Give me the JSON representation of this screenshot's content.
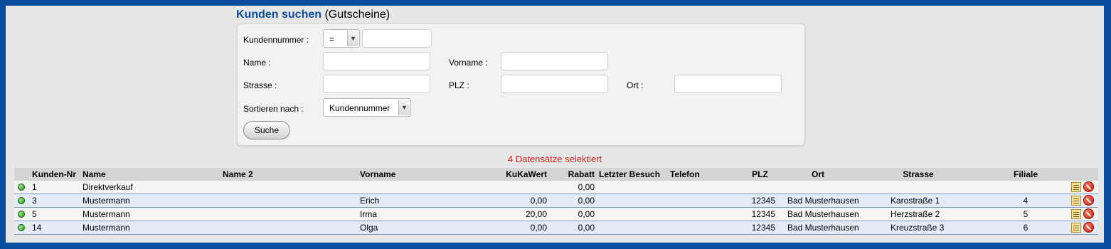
{
  "header": {
    "title": "Kunden suchen",
    "subtitle": "(Gutscheine)"
  },
  "form": {
    "kundennummer_label": "Kundennummer :",
    "kundennummer_operator": "=",
    "kundennummer_value": "",
    "name_label": "Name :",
    "vorname_label": "Vorname :",
    "strasse_label": "Strasse :",
    "plz_label": "PLZ :",
    "ort_label": "Ort :",
    "sort_label": "Sortieren nach :",
    "sort_value": "Kundennummer",
    "search_button": "Suche"
  },
  "status": "4 Datensätze selektiert",
  "table": {
    "columns": [
      "Kunden-Nr",
      "Name",
      "Name 2",
      "Vorname",
      "KuKaWert",
      "Rabatt",
      "Letzter Besuch",
      "Telefon",
      "PLZ",
      "Ort",
      "Strasse",
      "Filiale"
    ],
    "rows": [
      {
        "nr": "1",
        "name": "Direktverkauf",
        "name2": "",
        "vorname": "",
        "kukawert": "",
        "rabatt": "0,00",
        "besuch": "",
        "telefon": "",
        "plz": "",
        "ort": "",
        "strasse": "",
        "filiale": ""
      },
      {
        "nr": "3",
        "name": "Mustermann",
        "name2": "",
        "vorname": "Erich",
        "kukawert": "0,00",
        "rabatt": "0,00",
        "besuch": "",
        "telefon": "",
        "plz": "12345",
        "ort": "Bad Musterhausen",
        "strasse": "Karostraße 1",
        "filiale": "4"
      },
      {
        "nr": "5",
        "name": "Mustermann",
        "name2": "",
        "vorname": "Irma",
        "kukawert": "20,00",
        "rabatt": "0,00",
        "besuch": "",
        "telefon": "",
        "plz": "12345",
        "ort": "Bad Musterhausen",
        "strasse": "Herzstraße 2",
        "filiale": "5"
      },
      {
        "nr": "14",
        "name": "Mustermann",
        "name2": "",
        "vorname": "Olga",
        "kukawert": "0,00",
        "rabatt": "0,00",
        "besuch": "",
        "telefon": "",
        "plz": "12345",
        "ort": "Bad Musterhausen",
        "strasse": "Kreuzstraße 3",
        "filiale": "6"
      }
    ]
  },
  "icons": {
    "status": "green-dot-icon",
    "edit": "edit-icon",
    "delete": "delete-icon"
  }
}
